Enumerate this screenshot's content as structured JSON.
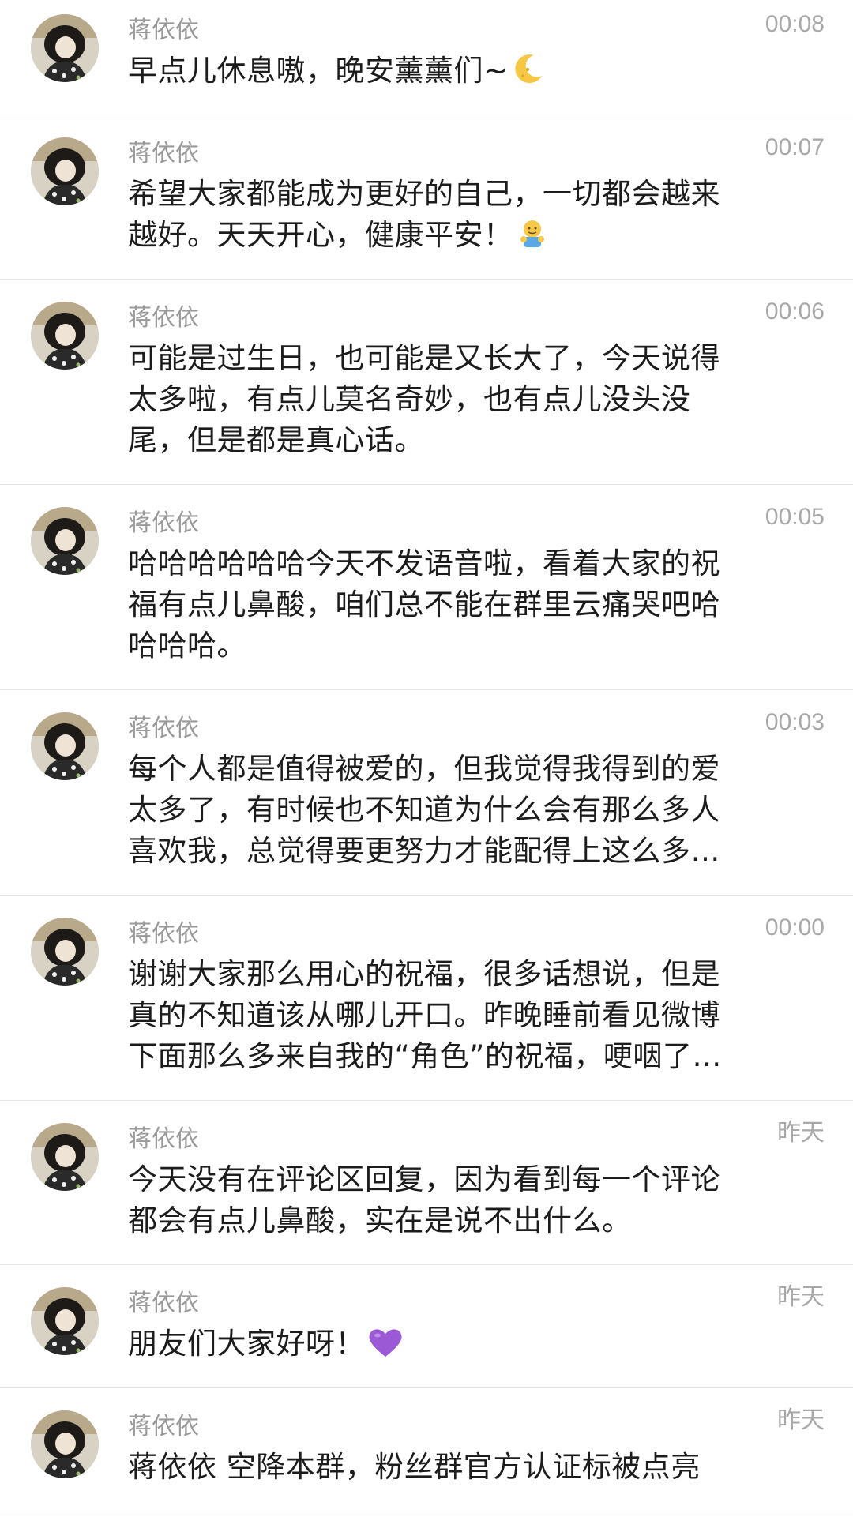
{
  "messages": [
    {
      "name": "蒋依依",
      "time": "00:08",
      "text": "早点儿休息嗷，晚安薰薰们~",
      "emoji": "crescent-moon"
    },
    {
      "name": "蒋依依",
      "time": "00:07",
      "text": "希望大家都能成为更好的自己，一切都会越来越好。天天开心，健康平安！",
      "emoji": "hug-emoji"
    },
    {
      "name": "蒋依依",
      "time": "00:06",
      "text": "可能是过生日，也可能是又长大了，今天说得太多啦，有点儿莫名奇妙，也有点儿没头没尾，但是都是真心话。"
    },
    {
      "name": "蒋依依",
      "time": "00:05",
      "text": "哈哈哈哈哈哈今天不发语音啦，看着大家的祝福有点儿鼻酸，咱们总不能在群里云痛哭吧哈哈哈哈。"
    },
    {
      "name": "蒋依依",
      "time": "00:03",
      "text": "每个人都是值得被爱的，但我觉得我得到的爱太多了，有时候也不知道为什么会有那么多人喜欢我，总觉得要更努力才能配得上这么多…"
    },
    {
      "name": "蒋依依",
      "time": "00:00",
      "text": "谢谢大家那么用心的祝福，很多话想说，但是真的不知道该从哪儿开口。昨晚睡前看见微博下面那么多来自我的“角色”的祝福，哽咽了…"
    },
    {
      "name": "蒋依依",
      "time": "昨天",
      "text": "今天没有在评论区回复，因为看到每一个评论都会有点儿鼻酸，实在是说不出什么。"
    },
    {
      "name": "蒋依依",
      "time": "昨天",
      "text": "朋友们大家好呀！",
      "emoji": "purple-heart"
    },
    {
      "name": "蒋依依",
      "time": "昨天",
      "text": "蒋依依 空降本群，粉丝群官方认证标被点亮"
    }
  ]
}
